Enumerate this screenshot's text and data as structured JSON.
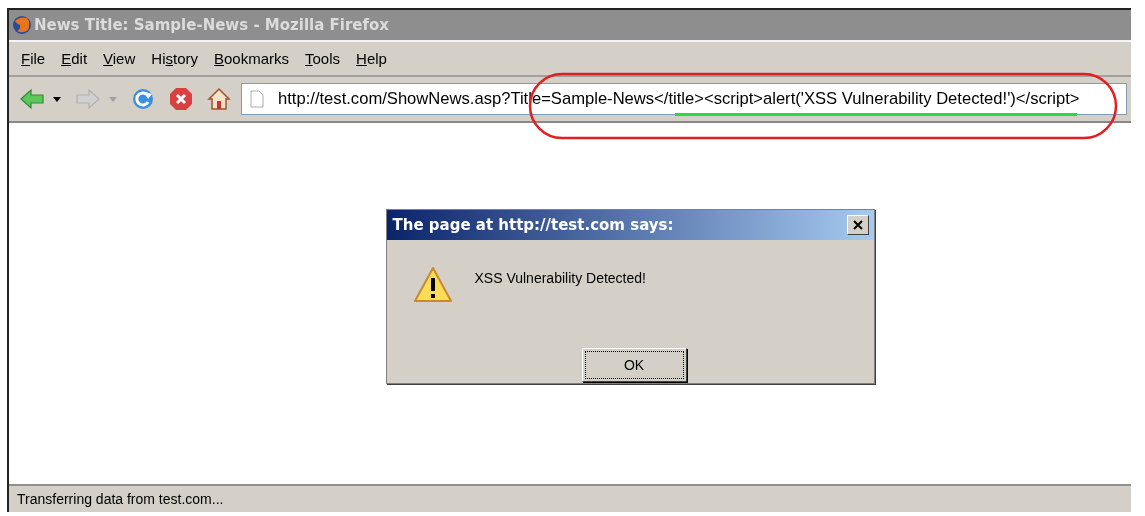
{
  "window": {
    "title": "News Title: Sample-News - Mozilla Firefox",
    "active": false
  },
  "menu": [
    {
      "access_key": "F",
      "rest": "ile"
    },
    {
      "access_key": "E",
      "rest": "dit"
    },
    {
      "access_key": "V",
      "rest": "iew"
    },
    {
      "lead": "Hi",
      "access_key": "s",
      "rest": "tory"
    },
    {
      "access_key": "B",
      "rest": "ookmarks"
    },
    {
      "access_key": "T",
      "rest": "ools"
    },
    {
      "access_key": "H",
      "rest": "elp"
    }
  ],
  "nav_buttons": [
    {
      "kind": "back",
      "disabled": false
    },
    {
      "kind": "dropdown",
      "disabled": false
    },
    {
      "kind": "forward",
      "disabled": true
    },
    {
      "kind": "dropdown",
      "disabled": true
    },
    {
      "kind": "reload",
      "disabled": false
    },
    {
      "kind": "stop",
      "disabled": false
    },
    {
      "kind": "home",
      "disabled": false
    }
  ],
  "address_bar": {
    "value": "http://test.com/ShowNews.asp?Title=Sample-News</title><script>alert('XSS Vulnerability Detected!')</script>"
  },
  "dialog": {
    "title": "The page at http://test.com says:",
    "message": "XSS Vulnerability Detected!",
    "buttons": [
      {
        "label": "OK",
        "focused": true
      }
    ]
  },
  "status_bar": {
    "text": "Transferring data from test.com..."
  }
}
